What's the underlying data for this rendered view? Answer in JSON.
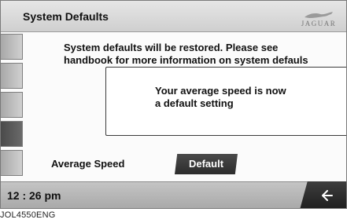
{
  "header": {
    "title": "System Defaults",
    "logo_text": "JAGUAR",
    "logo_icon": "jaguar-leaper-icon"
  },
  "message": {
    "line1": "System defaults will be restored. Please see",
    "line2": "handbook for more information on system defauls"
  },
  "popup": {
    "text": "Your average speed is now\na default setting"
  },
  "setting": {
    "label": "Average Speed",
    "button_label": "Default"
  },
  "footer": {
    "clock": "12 : 26 pm",
    "back_icon": "back-arrow-icon"
  },
  "figure": {
    "reference": "JOL4550ENG"
  }
}
